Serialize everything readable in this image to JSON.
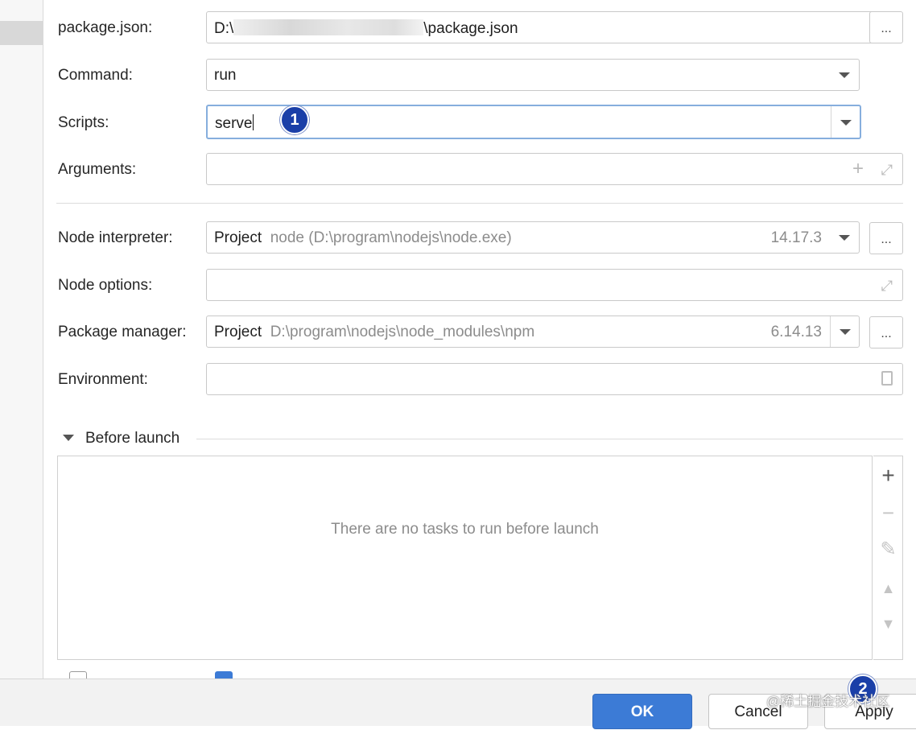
{
  "form": {
    "package_json": {
      "label": "package.json:",
      "prefix": "D:\\",
      "suffix": "\\package.json"
    },
    "command": {
      "label": "Command:",
      "value": "run"
    },
    "scripts": {
      "label": "Scripts:",
      "value": "serve"
    },
    "arguments": {
      "label": "Arguments:",
      "value": ""
    },
    "node_interpreter": {
      "label": "Node interpreter:",
      "scope": "Project",
      "path": "node (D:\\program\\nodejs\\node.exe)",
      "version": "14.17.3"
    },
    "node_options": {
      "label": "Node options:",
      "value": ""
    },
    "package_manager": {
      "label": "Package manager:",
      "scope": "Project",
      "path": "D:\\program\\nodejs\\node_modules\\npm",
      "version": "6.14.13"
    },
    "environment": {
      "label": "Environment:",
      "value": ""
    },
    "browse_label": "..."
  },
  "before_launch": {
    "title": "Before launch",
    "empty_text": "There are no tasks to run before launch",
    "tools": {
      "add": "+",
      "remove": "−",
      "edit": "✎",
      "up": "▲",
      "down": "▼"
    }
  },
  "annotations": {
    "step1": "1",
    "step2": "2"
  },
  "footer": {
    "ok_label": "OK",
    "cancel_label": "Cancel",
    "apply_label": "Apply"
  },
  "watermark": "@稀土掘金技术社区",
  "icons": {
    "arguments": [
      "plus-icon",
      "expand-icon"
    ],
    "node_options": "expand-icon",
    "environment": "document-icon",
    "dropdown": "chevron-down-icon"
  },
  "colors": {
    "accent": "#3c7bd6",
    "badge": "#1a3fa8",
    "focus_border": "#86aedd"
  }
}
